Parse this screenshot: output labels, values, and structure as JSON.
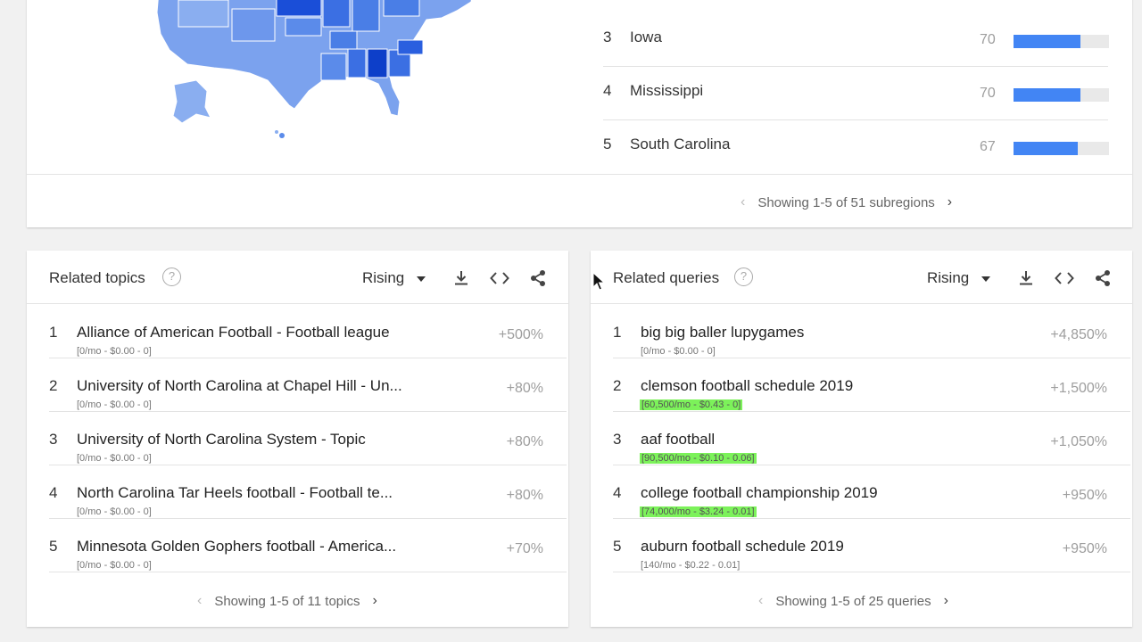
{
  "colors": {
    "accent": "#4285f4",
    "highlight": "#7cf25a",
    "map_dark": "#1a4ed8",
    "map_mid": "#4a7ee6",
    "map_light": "#7ba2ee"
  },
  "regions": {
    "rows": [
      {
        "rank": "3",
        "name": "Iowa",
        "value": "70",
        "fraction": 0.7
      },
      {
        "rank": "4",
        "name": "Mississippi",
        "value": "70",
        "fraction": 0.7
      },
      {
        "rank": "5",
        "name": "South Carolina",
        "value": "67",
        "fraction": 0.67
      }
    ],
    "pager_text": "Showing 1-5 of 51 subregions"
  },
  "topics": {
    "title": "Related topics",
    "filter": "Rising",
    "rows": [
      {
        "rank": "1",
        "label": "Alliance of American Football - Football league",
        "sub": "[0/mo - $0.00 - 0]",
        "change": "+500%"
      },
      {
        "rank": "2",
        "label": "University of North Carolina at Chapel Hill - Un...",
        "sub": "[0/mo - $0.00 - 0]",
        "change": "+80%"
      },
      {
        "rank": "3",
        "label": "University of North Carolina System - Topic",
        "sub": "[0/mo - $0.00 - 0]",
        "change": "+80%"
      },
      {
        "rank": "4",
        "label": "North Carolina Tar Heels football - Football te...",
        "sub": "[0/mo - $0.00 - 0]",
        "change": "+80%"
      },
      {
        "rank": "5",
        "label": "Minnesota Golden Gophers football - America...",
        "sub": "[0/mo - $0.00 - 0]",
        "change": "+70%"
      }
    ],
    "pager_text": "Showing 1-5 of 11 topics"
  },
  "queries": {
    "title": "Related queries",
    "filter": "Rising",
    "rows": [
      {
        "rank": "1",
        "label": "big big baller lupygames",
        "sub": "[0/mo - $0.00 - 0]",
        "change": "+4,850%"
      },
      {
        "rank": "2",
        "label": "clemson football schedule 2019",
        "sub": "[60,500/mo - $0.43 - 0]",
        "change": "+1,500%"
      },
      {
        "rank": "3",
        "label": "aaf football",
        "sub": "[90,500/mo - $0.10 - 0.06]",
        "change": "+1,050%"
      },
      {
        "rank": "4",
        "label": "college football championship 2019",
        "sub": "[74,000/mo - $3.24 - 0.01]",
        "change": "+950%"
      },
      {
        "rank": "5",
        "label": "auburn football schedule 2019",
        "sub": "[140/mo - $0.22 - 0.01]",
        "change": "+950%"
      }
    ],
    "pager_text": "Showing 1-5 of 25 queries"
  },
  "icons": {
    "help": "?",
    "download": "download-icon",
    "embed": "embed-icon",
    "share": "share-icon",
    "prev": "‹",
    "next": "›"
  }
}
